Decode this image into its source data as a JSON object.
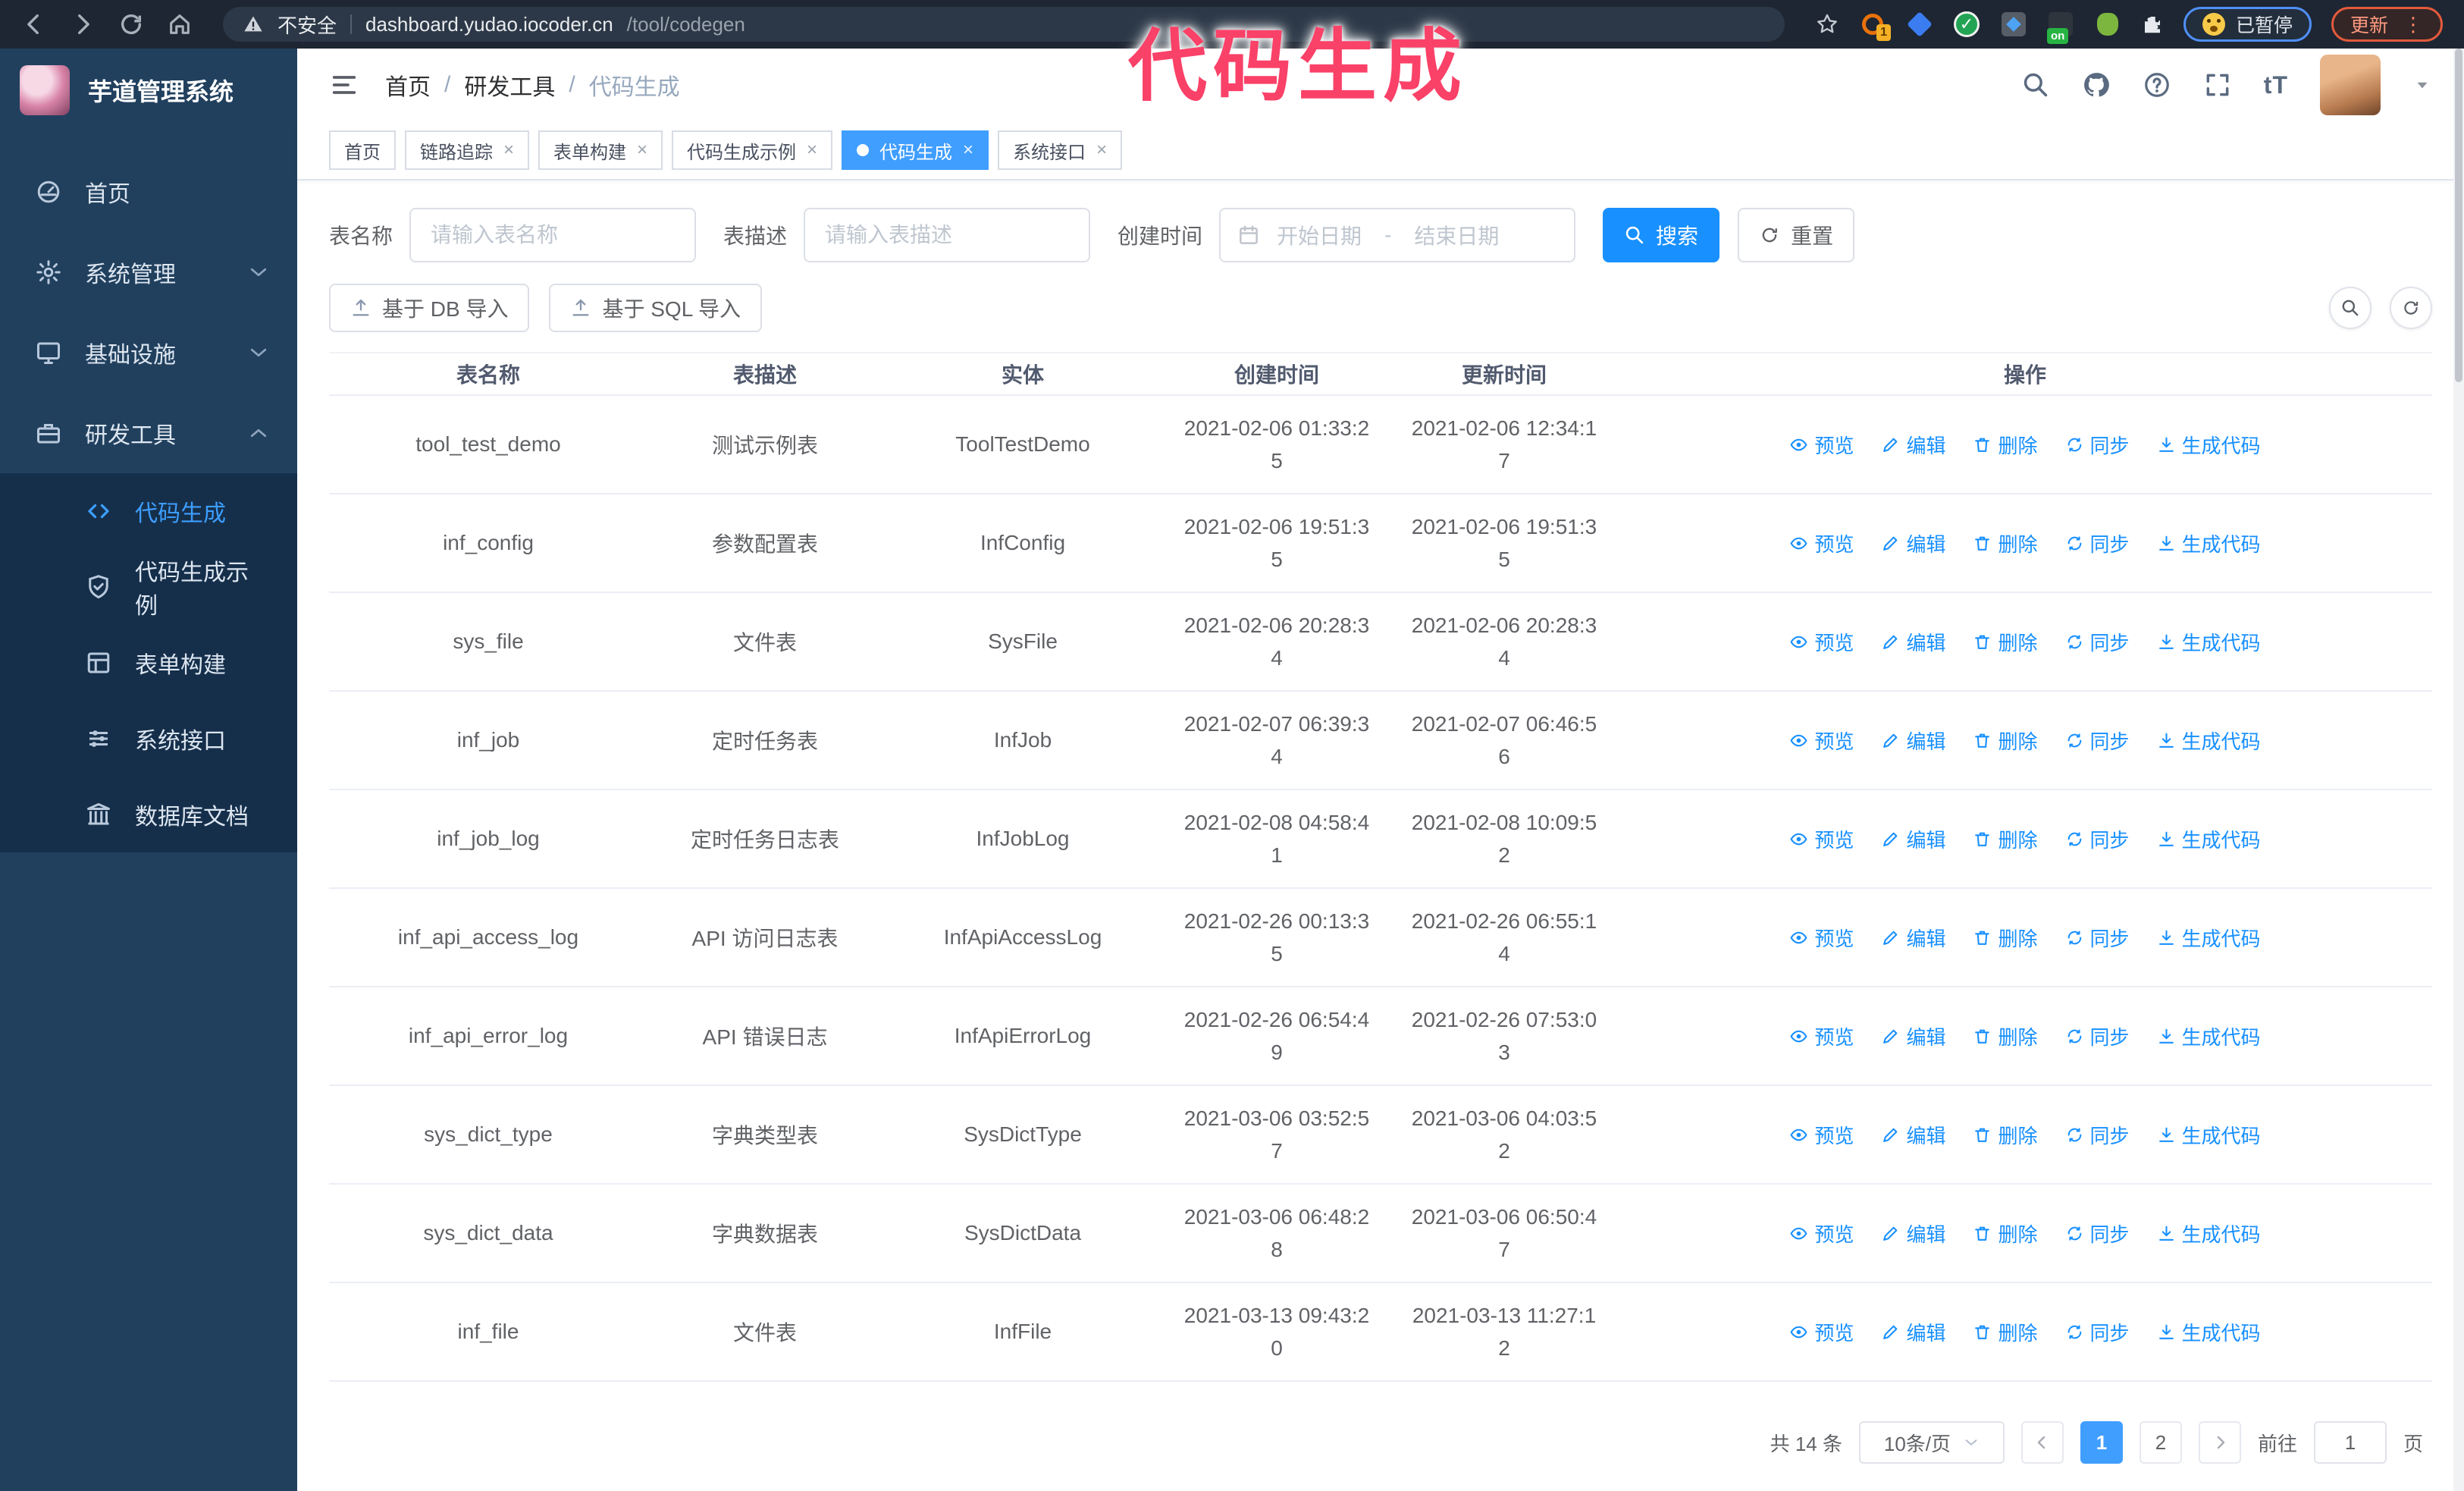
{
  "browser": {
    "security_label": "不安全",
    "url_host": "dashboard.yudao.iocoder.cn",
    "url_path": "/tool/codegen",
    "extension_badge_1": "1",
    "extension_badge_on": "on",
    "checkmark_glyph": "✓",
    "paused_pill_label": "已暂停",
    "update_button_label": "更新",
    "menu_dots_glyph": "⋮"
  },
  "annotation": {
    "text": "代码生成",
    "color": "#fa4168"
  },
  "sidebar": {
    "app_title": "芋道管理系统",
    "items": [
      {
        "label": "首页"
      },
      {
        "label": "系统管理"
      },
      {
        "label": "基础设施"
      },
      {
        "label": "研发工具"
      }
    ],
    "submenu": [
      {
        "label": "代码生成",
        "active": true
      },
      {
        "label": "代码生成示例",
        "active": false
      },
      {
        "label": "表单构建",
        "active": false
      },
      {
        "label": "系统接口",
        "active": false
      },
      {
        "label": "数据库文档",
        "active": false
      }
    ]
  },
  "header": {
    "breadcrumb": [
      "首页",
      "研发工具",
      "代码生成"
    ],
    "separator": "/",
    "text_size_glyph": "tT"
  },
  "icons": {
    "close_glyph": "×"
  },
  "tabs": [
    {
      "label": "首页",
      "closable": false,
      "active": false
    },
    {
      "label": "链路追踪",
      "closable": true,
      "active": false
    },
    {
      "label": "表单构建",
      "closable": true,
      "active": false
    },
    {
      "label": "代码生成示例",
      "closable": true,
      "active": false
    },
    {
      "label": "代码生成",
      "closable": true,
      "active": true
    },
    {
      "label": "系统接口",
      "closable": true,
      "active": false
    }
  ],
  "filters": {
    "table_name_label": "表名称",
    "table_name_placeholder": "请输入表名称",
    "table_desc_label": "表描述",
    "table_desc_placeholder": "请输入表描述",
    "create_time_label": "创建时间",
    "start_placeholder": "开始日期",
    "range_separator": "-",
    "end_placeholder": "结束日期",
    "search_label": "搜索",
    "reset_label": "重置"
  },
  "toolbar": {
    "import_db_label": "基于 DB 导入",
    "import_sql_label": "基于 SQL 导入"
  },
  "table": {
    "columns": [
      "表名称",
      "表描述",
      "实体",
      "创建时间",
      "更新时间",
      "操作"
    ],
    "actions": [
      {
        "label": "预览",
        "name": "action-preview",
        "icon": "eye-icon",
        "symbol": "i-eye"
      },
      {
        "label": "编辑",
        "name": "action-edit",
        "icon": "pencil-icon",
        "symbol": "i-edit"
      },
      {
        "label": "删除",
        "name": "action-delete",
        "icon": "trash-icon",
        "symbol": "i-trash"
      },
      {
        "label": "同步",
        "name": "action-sync",
        "icon": "sync-icon",
        "symbol": "i-sync"
      },
      {
        "label": "生成代码",
        "name": "action-generate-code",
        "icon": "download-icon",
        "symbol": "i-download"
      }
    ],
    "rows": [
      {
        "name": "tool_test_demo",
        "desc": "测试示例表",
        "entity": "ToolTestDemo",
        "created": "2021-02-06 01:33:25",
        "updated": "2021-02-06 12:34:17"
      },
      {
        "name": "inf_config",
        "desc": "参数配置表",
        "entity": "InfConfig",
        "created": "2021-02-06 19:51:35",
        "updated": "2021-02-06 19:51:35"
      },
      {
        "name": "sys_file",
        "desc": "文件表",
        "entity": "SysFile",
        "created": "2021-02-06 20:28:34",
        "updated": "2021-02-06 20:28:34"
      },
      {
        "name": "inf_job",
        "desc": "定时任务表",
        "entity": "InfJob",
        "created": "2021-02-07 06:39:34",
        "updated": "2021-02-07 06:46:56"
      },
      {
        "name": "inf_job_log",
        "desc": "定时任务日志表",
        "entity": "InfJobLog",
        "created": "2021-02-08 04:58:41",
        "updated": "2021-02-08 10:09:52"
      },
      {
        "name": "inf_api_access_log",
        "desc": "API 访问日志表",
        "entity": "InfApiAccessLog",
        "created": "2021-02-26 00:13:35",
        "updated": "2021-02-26 06:55:14"
      },
      {
        "name": "inf_api_error_log",
        "desc": "API 错误日志",
        "entity": "InfApiErrorLog",
        "created": "2021-02-26 06:54:49",
        "updated": "2021-02-26 07:53:03"
      },
      {
        "name": "sys_dict_type",
        "desc": "字典类型表",
        "entity": "SysDictType",
        "created": "2021-03-06 03:52:57",
        "updated": "2021-03-06 04:03:52"
      },
      {
        "name": "sys_dict_data",
        "desc": "字典数据表",
        "entity": "SysDictData",
        "created": "2021-03-06 06:48:28",
        "updated": "2021-03-06 06:50:47"
      },
      {
        "name": "inf_file",
        "desc": "文件表",
        "entity": "InfFile",
        "created": "2021-03-13 09:43:20",
        "updated": "2021-03-13 11:27:12"
      }
    ]
  },
  "pagination": {
    "total_label": "共 14 条",
    "page_size": "10条/页",
    "pages": [
      "1",
      "2"
    ],
    "active_page": "1",
    "goto_label": "前往",
    "goto_value": "1",
    "page_suffix": "页"
  }
}
